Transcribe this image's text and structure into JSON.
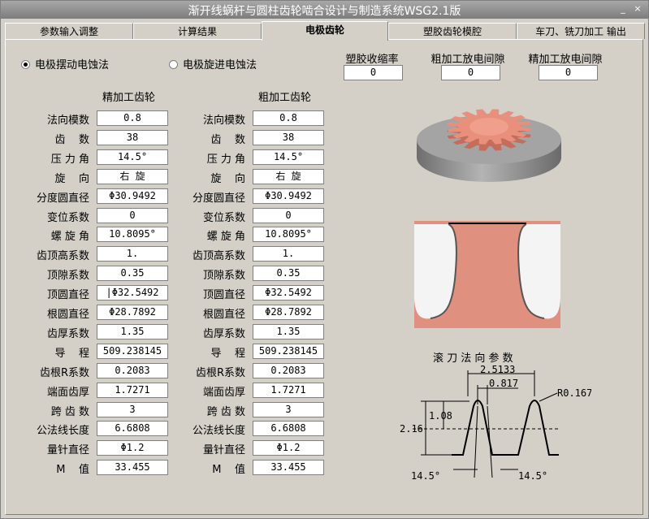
{
  "window": {
    "title": "渐开线蜗杆与圆柱齿轮啮合设计与制造系统WSG2.1版",
    "minimize": "_",
    "close": "×"
  },
  "tabs": [
    {
      "label": "参数输入调整",
      "active": false
    },
    {
      "label": "计算结果",
      "active": false
    },
    {
      "label": "电极齿轮",
      "active": true
    },
    {
      "label": "塑胶齿轮模腔",
      "active": false
    },
    {
      "label": "车刀、铣刀加工  输出",
      "active": false
    }
  ],
  "method": {
    "option1": "电极摆动电蚀法",
    "option2": "电极旋进电蚀法",
    "selected": "option1"
  },
  "top_fields": [
    {
      "label": "塑胶收缩率",
      "value": "0"
    },
    {
      "label": "粗加工放电间隙",
      "value": "0"
    },
    {
      "label": "精加工放电间隙",
      "value": "0"
    }
  ],
  "finish": {
    "heading": "精加工齿轮",
    "labels": [
      "法向模数",
      "齿    数",
      "压 力 角",
      "旋    向",
      "分度圆直径",
      "变位系数",
      "螺 旋 角",
      "齿顶高系数",
      "顶隙系数",
      "顶圆直径",
      "根圆直径",
      "齿厚系数",
      "导    程",
      "齿根R系数",
      "端面齿厚",
      "跨 齿 数",
      "公法线长度",
      "量针直径",
      "M    值"
    ],
    "values": [
      "0.8",
      "38",
      "14.5°",
      "右 旋",
      "Φ30.9492",
      "0",
      "10.8095°",
      "1.",
      "0.35",
      "|Φ32.5492",
      "Φ28.7892",
      "1.35",
      "509.238145",
      "0.2083",
      "1.7271",
      "3",
      "6.6808",
      "Φ1.2",
      "33.455"
    ]
  },
  "rough": {
    "heading": "粗加工齿轮",
    "labels": [
      "法向模数",
      "齿    数",
      "压 力 角",
      "旋    向",
      "分度圆直径",
      "变位系数",
      "螺 旋 角",
      "齿顶高系数",
      "顶隙系数",
      "顶圆直径",
      "根圆直径",
      "齿厚系数",
      "导    程",
      "齿根R系数",
      "端面齿厚",
      "跨 齿 数",
      "公法线长度",
      "量针直径",
      "M    值"
    ],
    "values": [
      "0.8",
      "38",
      "14.5°",
      "右 旋",
      "Φ30.9492",
      "0",
      "10.8095°",
      "1.",
      "0.35",
      "Φ32.5492",
      "Φ28.7892",
      "1.35",
      "509.238145",
      "0.2083",
      "1.7271",
      "3",
      "6.6808",
      "Φ1.2",
      "33.455"
    ]
  },
  "hob": {
    "title": "滚 刀 法 向 参 数",
    "pitch": "2.5133",
    "tooth_width": "0.817",
    "radius": "R0.167",
    "addendum": "1.08",
    "depth": "2.16",
    "angle_left": "14.5°",
    "angle_right": "14.5°"
  },
  "colors": {
    "gear": "#e8907c",
    "base": "#8c8c8c",
    "accent_tab": "#d4d0c8"
  }
}
